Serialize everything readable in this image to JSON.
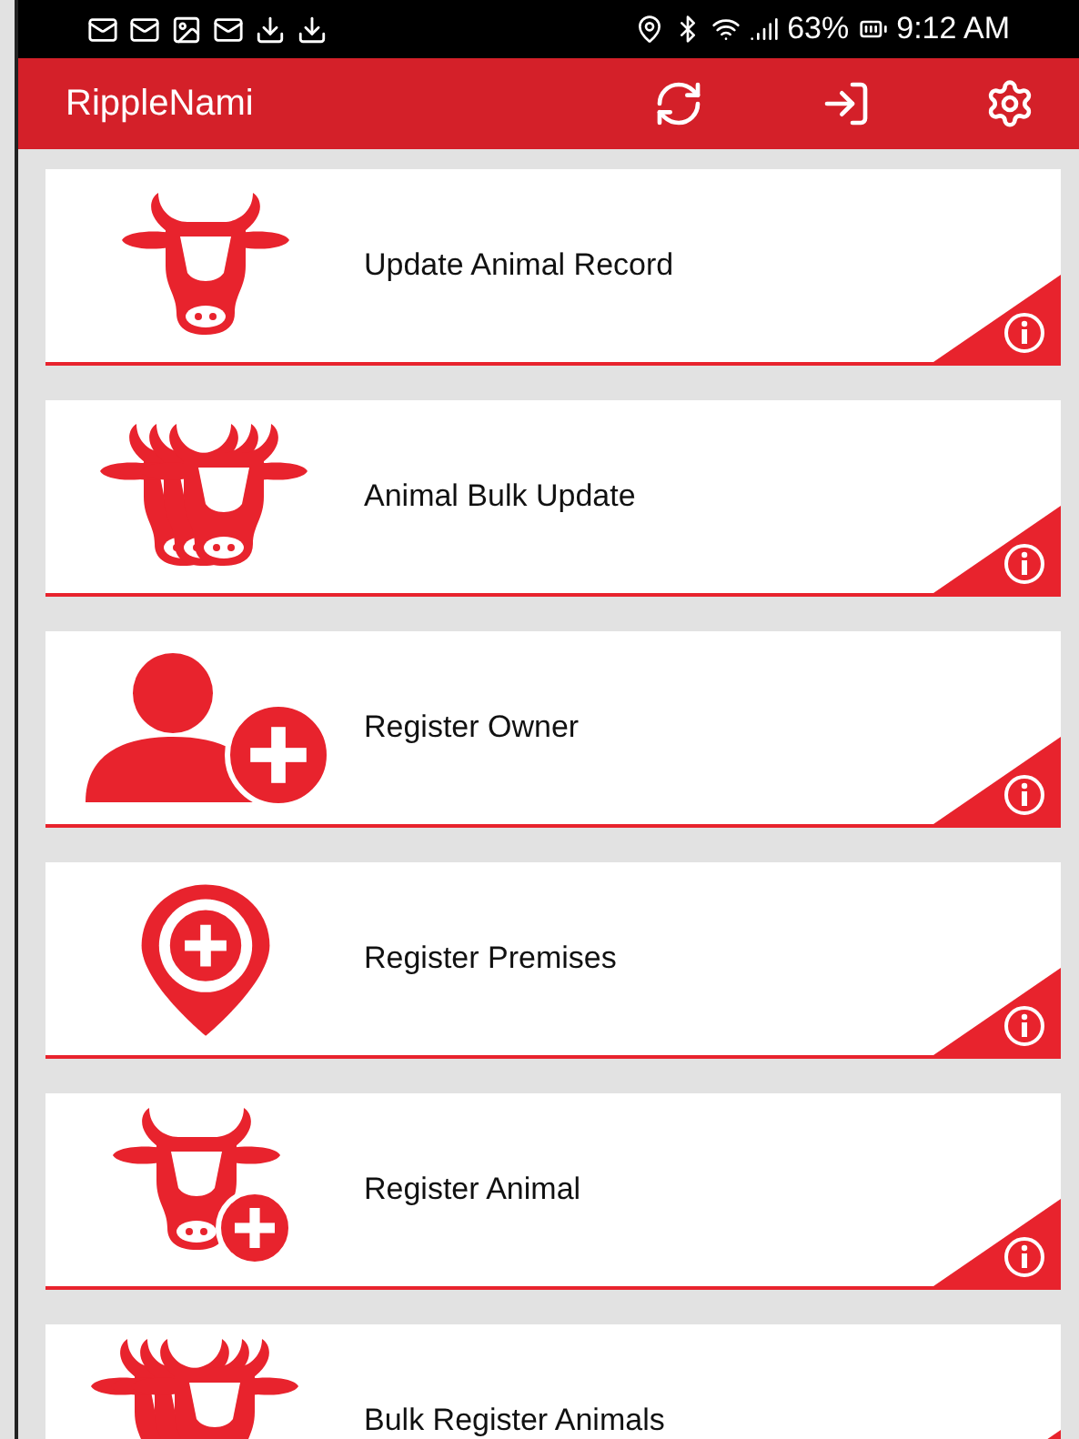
{
  "status_bar": {
    "battery": "63%",
    "time": "9:12 AM"
  },
  "app_bar": {
    "title": "RippleNami"
  },
  "menu": [
    {
      "kind": "cow",
      "label": "Update Animal Record"
    },
    {
      "kind": "herd",
      "label": "Animal Bulk Update"
    },
    {
      "kind": "owner-add",
      "label": "Register Owner"
    },
    {
      "kind": "premises-add",
      "label": "Register Premises"
    },
    {
      "kind": "cow-add",
      "label": "Register Animal"
    },
    {
      "kind": "herd-add",
      "label": "Bulk Register Animals"
    }
  ]
}
